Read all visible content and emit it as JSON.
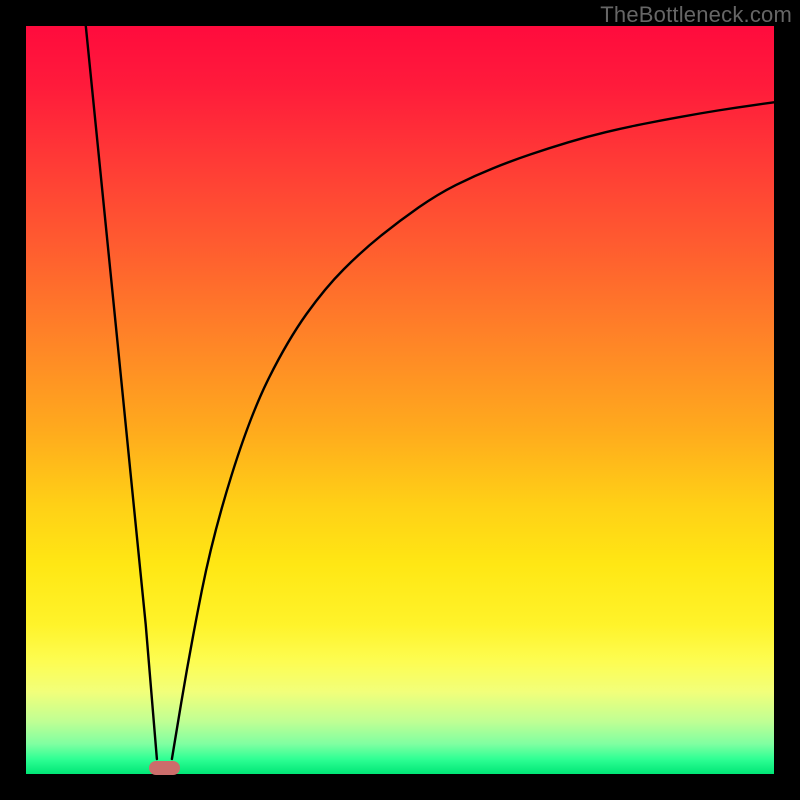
{
  "watermark": "TheBottleneck.com",
  "colors": {
    "frame": "#000000",
    "curve": "#000000",
    "marker": "#cc6d6b"
  },
  "chart_data": {
    "type": "line",
    "title": "",
    "xlabel": "",
    "ylabel": "",
    "xlim": [
      0,
      100
    ],
    "ylim": [
      0,
      100
    ],
    "grid": false,
    "legend": false,
    "description": "Bottleneck-style V curve: left branch is a steep straight line descending from (x≈8, y≈100) to a minimum near x≈18; right branch rises asymptotically from the minimum toward y≈90 at x=100. Lower y = better (green zone at bottom).",
    "series": [
      {
        "name": "left_branch",
        "x": [
          8,
          10,
          12,
          14,
          16,
          17.5
        ],
        "values": [
          100,
          80,
          60,
          40,
          20,
          2
        ]
      },
      {
        "name": "right_branch",
        "x": [
          19.5,
          22,
          25,
          30,
          35,
          40,
          45,
          50,
          55,
          60,
          65,
          70,
          75,
          80,
          85,
          90,
          95,
          100
        ],
        "values": [
          2,
          17,
          32,
          48,
          58,
          65,
          70,
          74,
          77.5,
          80,
          82,
          83.7,
          85.2,
          86.4,
          87.4,
          88.3,
          89.1,
          89.8
        ]
      }
    ],
    "marker": {
      "x_center": 18.5,
      "width_pct": 4.2,
      "y": 0.8
    }
  }
}
